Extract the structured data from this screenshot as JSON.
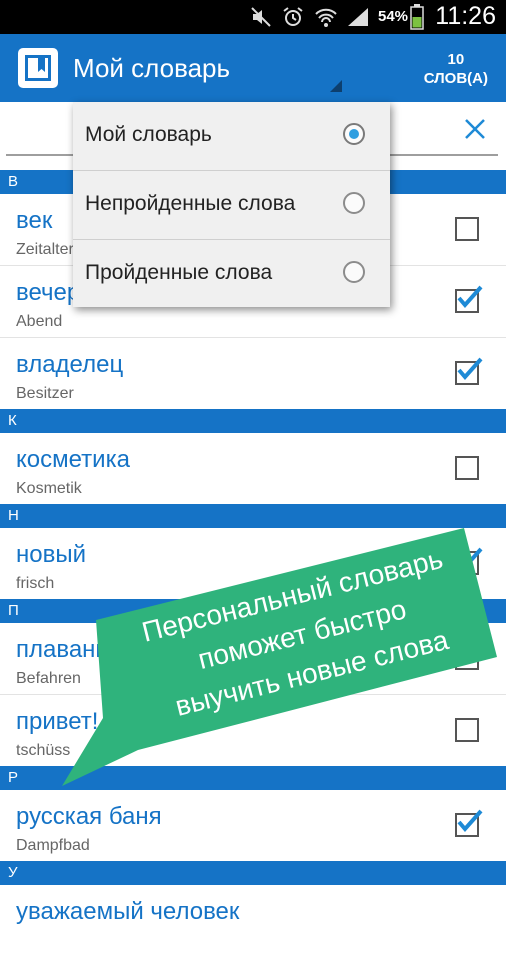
{
  "status_bar": {
    "battery_percent": "54%",
    "time": "11:26"
  },
  "app": {
    "title": "Мой словарь",
    "count_number": "10",
    "count_unit": "СЛОВ(А)"
  },
  "filter_menu": {
    "options": [
      {
        "label": "Мой словарь",
        "selected": true
      },
      {
        "label": "Непройденные слова",
        "selected": false
      },
      {
        "label": "Пройденные слова",
        "selected": false
      }
    ]
  },
  "sections": [
    {
      "letter": "В",
      "words": [
        {
          "word": "век",
          "translation": "Zeitalter",
          "checked": false
        },
        {
          "word": "вечер",
          "translation": "Abend",
          "checked": true
        },
        {
          "word": "владелец",
          "translation": "Besitzer",
          "checked": true
        }
      ]
    },
    {
      "letter": "К",
      "words": [
        {
          "word": "косметика",
          "translation": "Kosmetik",
          "checked": false
        }
      ]
    },
    {
      "letter": "Н",
      "words": [
        {
          "word": "новый",
          "translation": "frisch",
          "checked": true
        }
      ]
    },
    {
      "letter": "П",
      "words": [
        {
          "word": "плавание",
          "translation": "Befahren",
          "checked": true
        },
        {
          "word": "привет!",
          "translation": "tschüss",
          "checked": false
        }
      ]
    },
    {
      "letter": "Р",
      "words": [
        {
          "word": "русская баня",
          "translation": "Dampfbad",
          "checked": true
        }
      ]
    },
    {
      "letter": "У",
      "words": [
        {
          "word": "уважаемый человек",
          "translation": "",
          "checked": false
        }
      ]
    }
  ],
  "promo_banner": {
    "lines": [
      "Персональный словарь",
      "поможет быстро",
      "выучить новые слова"
    ],
    "color": "#2fb37c"
  },
  "colors": {
    "accent": "#1573c6",
    "radio_selected": "#2f9ee0"
  }
}
